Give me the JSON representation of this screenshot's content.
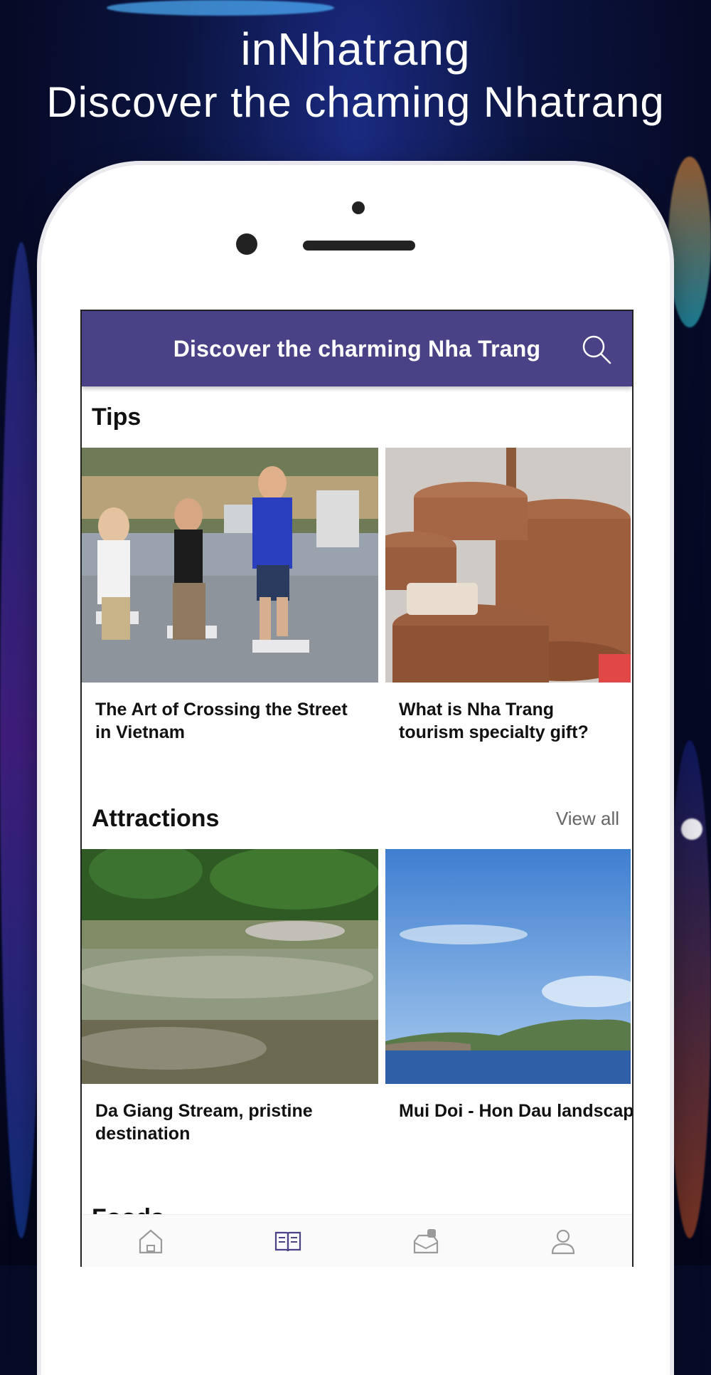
{
  "promo": {
    "app_name": "inNhatrang",
    "tagline": "Discover the chaming Nhatrang"
  },
  "appbar": {
    "title": "Discover the charming Nha Trang",
    "search_icon": "search-icon"
  },
  "tips": {
    "heading": "Tips",
    "cards": [
      {
        "title": "The Art of Crossing the Street in Vietnam"
      },
      {
        "title": "What is Nha Trang tourism specialty gift?"
      }
    ]
  },
  "attractions": {
    "heading": "Attractions",
    "view_all": "View all",
    "cards": [
      {
        "title": "Da Giang Stream, pristine destination"
      },
      {
        "title": "Mui Doi - Hon Dau landscape"
      }
    ]
  },
  "foods": {
    "heading": "Foods"
  },
  "tabbar": {
    "tabs": [
      {
        "icon": "home-icon",
        "active": false
      },
      {
        "icon": "book-icon",
        "active": true
      },
      {
        "icon": "inbox-icon",
        "active": false
      },
      {
        "icon": "user-icon",
        "active": false
      }
    ]
  },
  "colors": {
    "appbar": "#4a4286",
    "active_tab": "#4a4286",
    "inactive_tab": "#9a9a9a"
  }
}
